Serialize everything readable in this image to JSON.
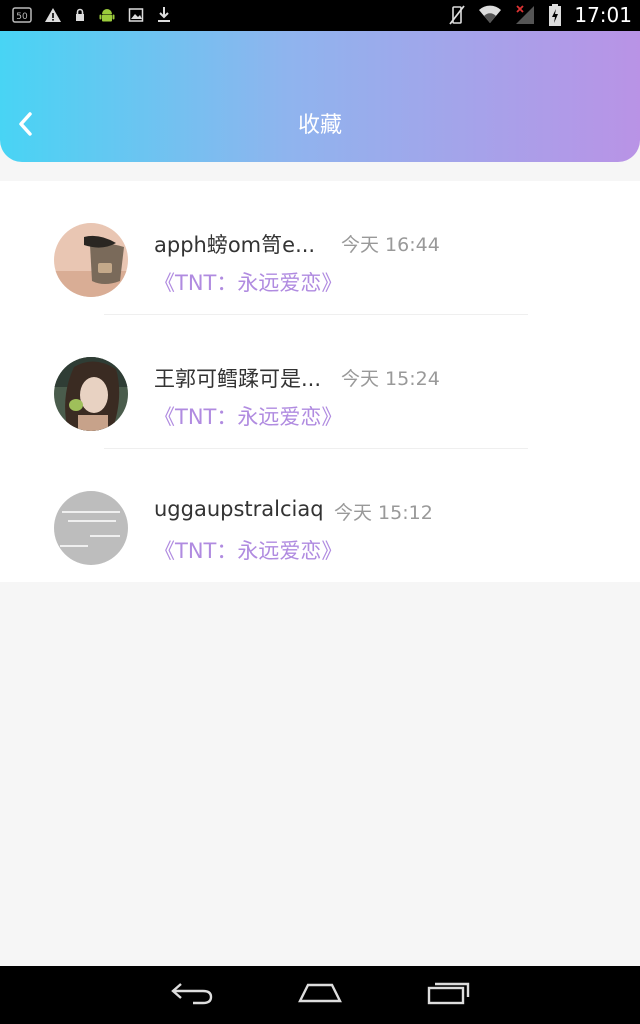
{
  "status_bar": {
    "time": "17:01",
    "left_icons": [
      "badge-50-icon",
      "warning-icon",
      "lock-icon",
      "android-icon",
      "image-icon",
      "download-icon"
    ],
    "right_icons": [
      "vibrate-off-icon",
      "wifi-icon",
      "signal-icon",
      "battery-icon"
    ],
    "notification_badge": "50"
  },
  "header": {
    "title": "收藏",
    "back_icon": "chevron-left-icon",
    "gradient_start": "#48d4f4",
    "gradient_end": "#b993e6"
  },
  "favorites": [
    {
      "name": "apph螃om笥e...",
      "time": "今天 16:44",
      "subtitle": "《TNT：永远爱恋》"
    },
    {
      "name": "王郭可鳕蹂可是...",
      "time": "今天 15:24",
      "subtitle": "《TNT：永远爱恋》"
    },
    {
      "name": "uggaupstralciaq",
      "time": "今天 15:12",
      "subtitle": "《TNT：永远爱恋》"
    }
  ],
  "nav_bar": {
    "icons": [
      "back-icon",
      "home-icon",
      "recent-apps-icon"
    ]
  },
  "colors": {
    "subtitle": "#b08be0",
    "page_background": "#f6f6f6"
  }
}
